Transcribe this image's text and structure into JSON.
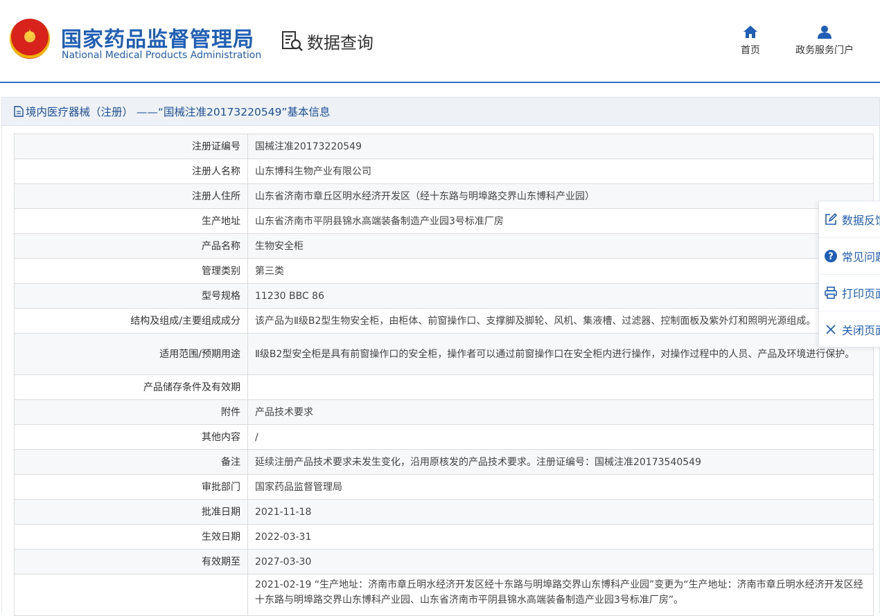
{
  "header": {
    "org_cn": "国家药品监督管理局",
    "org_en": "National Medical Products Administration",
    "query_label": "数据查询",
    "nav": [
      {
        "label": "首页",
        "icon": "home-icon"
      },
      {
        "label": "政务服务门户",
        "icon": "user-icon"
      }
    ]
  },
  "panel": {
    "title": "境内医疗器械（注册） ——“国械注准20173220549”基本信息"
  },
  "rows": [
    {
      "label": "注册证编号",
      "value": "国械注准20173220549"
    },
    {
      "label": "注册人名称",
      "value": "山东博科生物产业有限公司"
    },
    {
      "label": "注册人住所",
      "value": "山东省济南市章丘区明水经济开发区（经十东路与明埠路交界山东博科产业园）"
    },
    {
      "label": "生产地址",
      "value": "山东省济南市平阴县锦水高端装备制造产业园3号标准厂房"
    },
    {
      "label": "产品名称",
      "value": "生物安全柜"
    },
    {
      "label": "管理类别",
      "value": "第三类"
    },
    {
      "label": "型号规格",
      "value": "11230 BBC 86"
    },
    {
      "label": "结构及组成/主要组成成分",
      "value": "该产品为Ⅱ级B2型生物安全柜，由柜体、前窗操作口、支撑脚及脚轮、风机、集液槽、过滤器、控制面板及紫外灯和照明光源组成。"
    },
    {
      "label": "适用范围/预期用途",
      "value": "Ⅱ级B2型安全柜是具有前窗操作口的安全柜，操作者可以通过前窗操作口在安全柜内进行操作，对操作过程中的人员、产品及环境进行保护。"
    },
    {
      "label": "产品储存条件及有效期",
      "value": ""
    },
    {
      "label": "附件",
      "value": "产品技术要求"
    },
    {
      "label": "其他内容",
      "value": "/"
    },
    {
      "label": "备注",
      "value": "延续注册产品技术要求未发生变化，沿用原核发的产品技术要求。注册证编号：国械注准20173540549"
    },
    {
      "label": "审批部门",
      "value": "国家药品监督管理局"
    },
    {
      "label": "批准日期",
      "value": "2021-11-18"
    },
    {
      "label": "生效日期",
      "value": "2022-03-31"
    },
    {
      "label": "有效期至",
      "value": "2027-03-30"
    },
    {
      "label": "",
      "value": "2021-02-19 “生产地址：济南市章丘明水经济开发区经十东路与明埠路交界山东博科产业园”变更为“生产地址：济南市章丘明水经济开发区经十东路与明埠路交界山东博科产业园、山东省济南市平阴县锦水高端装备制造产业园3号标准厂房”。"
    }
  ],
  "sidebar": [
    {
      "label": "数据反馈",
      "icon": "edit-icon"
    },
    {
      "label": "常见问题",
      "icon": "question-icon"
    },
    {
      "label": "打印页面",
      "icon": "printer-icon"
    },
    {
      "label": "关闭页面",
      "icon": "close-icon"
    }
  ],
  "colors": {
    "brand": "#1f5fb5",
    "header_rule": "#2f6fbf",
    "row_alt": "#f7f8fa"
  }
}
